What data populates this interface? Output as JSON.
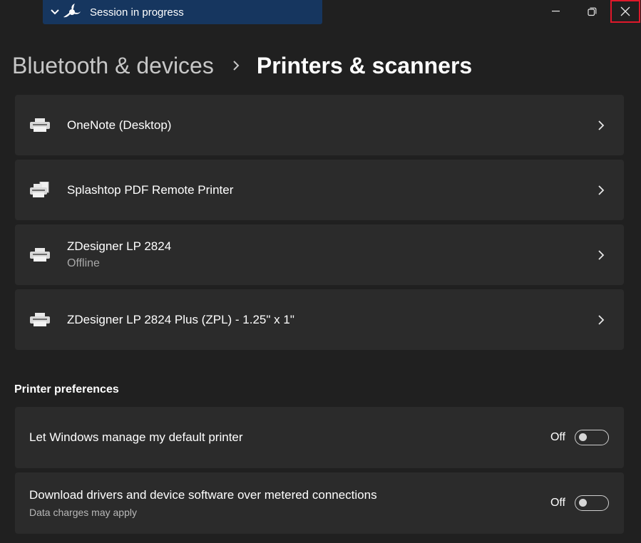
{
  "session_banner": {
    "text": "Session in progress"
  },
  "breadcrumb": {
    "parent": "Bluetooth & devices",
    "current": "Printers & scanners"
  },
  "printers": [
    {
      "name": "OneNote (Desktop)",
      "status": ""
    },
    {
      "name": "Splashtop PDF Remote Printer",
      "status": ""
    },
    {
      "name": "ZDesigner LP 2824",
      "status": "Offline"
    },
    {
      "name": "ZDesigner LP 2824 Plus (ZPL) - 1.25\" x 1\"",
      "status": ""
    }
  ],
  "preferences": {
    "title": "Printer preferences",
    "items": [
      {
        "label": "Let Windows manage my default printer",
        "sub": "",
        "state": "Off"
      },
      {
        "label": "Download drivers and device software over metered connections",
        "sub": "Data charges may apply",
        "state": "Off"
      }
    ]
  },
  "icons": {
    "session_logo": "splashtop-logo-icon",
    "printer": "printer-icon",
    "chevron": "chevron-right-icon"
  },
  "colors": {
    "background": "#202020",
    "card": "#2b2b2b",
    "banner": "#16365f",
    "close_highlight": "#e0182a"
  }
}
